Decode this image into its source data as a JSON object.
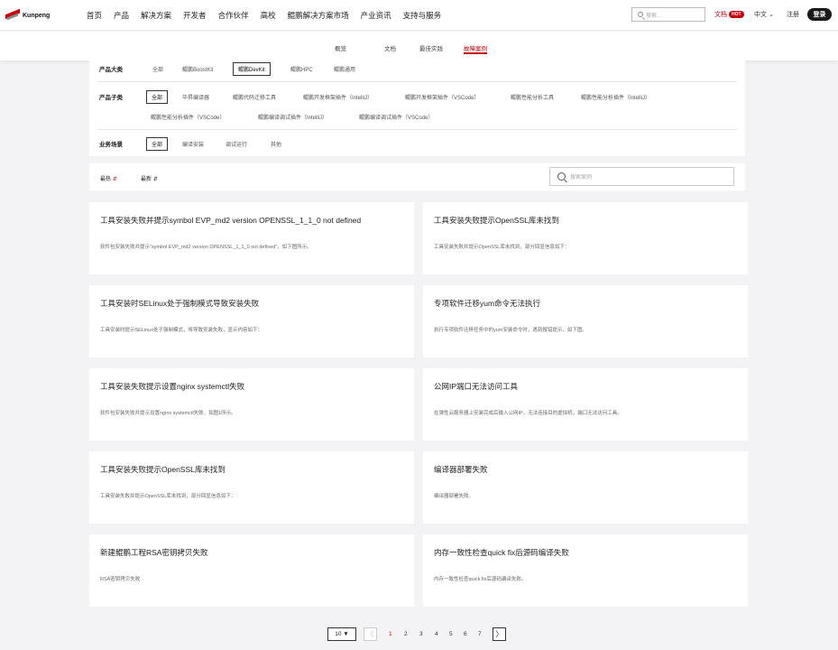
{
  "brand": {
    "name": "Kunpeng"
  },
  "nav": {
    "links": [
      "首页",
      "产品",
      "解决方案",
      "开发者",
      "合作伙伴",
      "高校",
      "鲲鹏解决方案市场",
      "产业资讯",
      "支持与服务"
    ],
    "search_placeholder": "搜索...",
    "docs": "文档",
    "hot": "HOT",
    "lang": "中文 ⌄",
    "register": "注册",
    "login": "登录"
  },
  "subtabs": [
    "概览",
    "文档",
    "最佳实践",
    "故障案例"
  ],
  "filters": {
    "product_category": {
      "label": "产品大类",
      "options": [
        "全部",
        "鲲鹏BoostKit",
        "鲲鹏DevKit",
        "鲲鹏HPC",
        "鲲鹏通用"
      ],
      "selected": "鲲鹏DevKit"
    },
    "product_subcategory": {
      "label": "产品子类",
      "options": [
        "全部",
        "毕昇编译器",
        "鲲鹏代码迁移工具",
        "鲲鹏开发框架插件（IntelliJ）",
        "鲲鹏开发框架插件（VSCode）",
        "鲲鹏性能分析工具",
        "鲲鹏性能分析插件（IntelliJ）",
        "鲲鹏性能分析插件（VSCode）",
        "鲲鹏编译调试插件（IntelliJ）",
        "鲲鹏编译调试插件（VSCode）"
      ],
      "selected": "全部"
    },
    "scenario": {
      "label": "业务场景",
      "options": [
        "全部",
        "编译安装",
        "调试运行",
        "其他"
      ],
      "selected": "全部"
    }
  },
  "sort": {
    "hot": "最热",
    "hot_arrow": "⇵",
    "new": "最新",
    "new_arrow": "⇵",
    "search_placeholder": "搜索案例"
  },
  "cards": [
    {
      "title": "工具安装失败并提示symbol EVP_md2 version OPENSSL_1_1_0 not defined",
      "desc": "软件包安装失败并提示“symbol EVP_md2 version OPENSSL_1_1_0 not defined”，如下图所示。"
    },
    {
      "title": "工具安装失败提示OpenSSL库未找到",
      "desc": "工具安装失败并提示OpenSSL库未找到，部分回显信息如下："
    },
    {
      "title": "工具安装时SELinux处于强制模式导致安装失败",
      "desc": "工具安装时提示SELinux处于强制模式，将导致安装失败，显示内容如下："
    },
    {
      "title": "专项软件迁移yum命令无法执行",
      "desc": "执行专项软件迁移任务中的yum安装命令时，遇到报错提示，如下图。"
    },
    {
      "title": "工具安装失败提示设置nginx systemctl失败",
      "desc": "软件包安装失败并提示设置nginx systemctl失败，如图1所示。"
    },
    {
      "title": "公网IP端口无法访问工具",
      "desc": "在弹性云服务器上安装完成后输入公网IP，无法连接目的虚拟机，端口无法访问工具。"
    },
    {
      "title": "工具安装失败提示OpenSSL库未找到",
      "desc": "工具安装失败并提示OpenSSL库未找到，部分回显信息如下："
    },
    {
      "title": "编译器部署失败",
      "desc": "编译器部署失败。"
    },
    {
      "title": "新建鲲鹏工程RSA密钥拷贝失败",
      "desc": "RSA密钥拷贝失败"
    },
    {
      "title": "内存一致性检查quick fix后源码编译失败",
      "desc": "内存一致性检查quick fix后源码编译失败。"
    }
  ],
  "pagination": {
    "page_size": "10 ▼",
    "prev": "〈",
    "pages": [
      "1",
      "2",
      "3",
      "4",
      "5",
      "6",
      "7"
    ],
    "current": "1",
    "next": "〉"
  },
  "colors": {
    "accent": "#c7000b",
    "background": "#f3f3f6"
  }
}
